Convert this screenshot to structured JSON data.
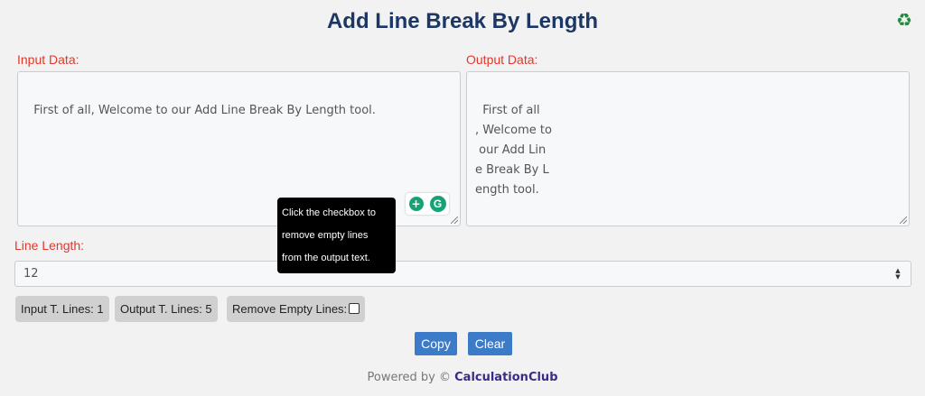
{
  "header": {
    "title": "Add Line Break By Length",
    "recycle_icon": "recycle-icon",
    "recycle_glyph": "♻"
  },
  "input": {
    "label": "Input Data:",
    "value": "First of all, Welcome to our Add Line Break By Length tool."
  },
  "output": {
    "label": "Output Data:",
    "value": "First of all\n, Welcome to\n our Add Lin\ne Break By L\nength tool."
  },
  "tooltip": {
    "lines": [
      "Click the checkbox to",
      "remove empty lines",
      "from the output text."
    ]
  },
  "line_length": {
    "label": "Line Length:",
    "value": "12"
  },
  "stats": {
    "input_lines": "Input T. Lines: 1",
    "output_lines": "Output T. Lines: 5",
    "remove_empty": "Remove Empty Lines:"
  },
  "buttons": {
    "copy": "Copy",
    "clear": "Clear"
  },
  "footer": {
    "prefix": "Powered by ©",
    "brand": "CalculationClub"
  },
  "colors": {
    "title": "#1c3765",
    "label": "#e2372c",
    "button": "#3c7bc7",
    "brand": "#3b2a8a"
  }
}
